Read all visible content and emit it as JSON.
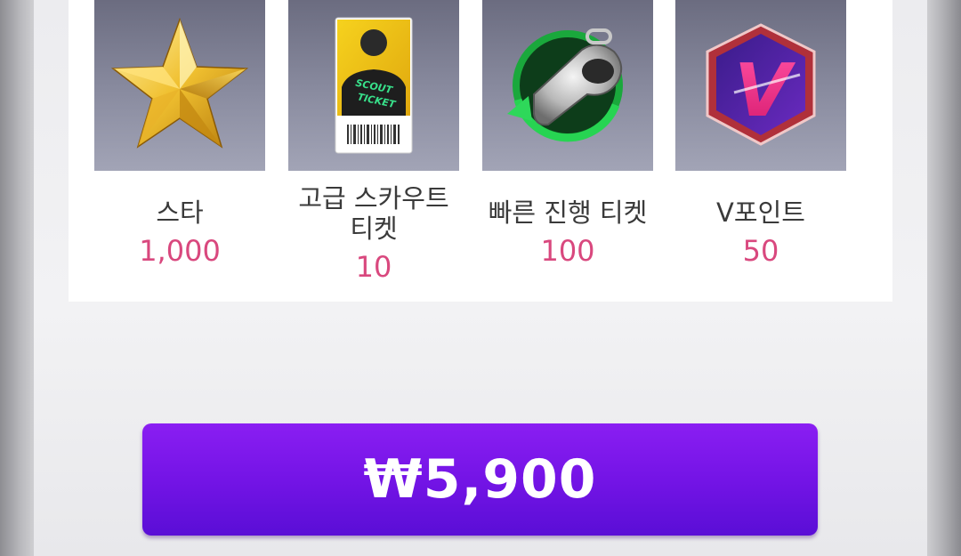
{
  "rewards": [
    {
      "name": "스타",
      "amount": "1,000",
      "icon": "star-icon"
    },
    {
      "name_line1": "고급 스카우트",
      "name_line2": "티켓",
      "amount": "10",
      "icon": "scout-ticket-icon",
      "ticket_text_1": "SCOUT",
      "ticket_text_2": "TICKET"
    },
    {
      "name": "빠른 진행 티켓",
      "amount": "100",
      "icon": "whistle-icon"
    },
    {
      "name": "V포인트",
      "amount": "50",
      "icon": "v-point-icon",
      "badge_letter": "V"
    }
  ],
  "purchase": {
    "price_label": "₩5,900"
  },
  "colors": {
    "accent": "#7414e6",
    "amount": "#d9487e"
  }
}
